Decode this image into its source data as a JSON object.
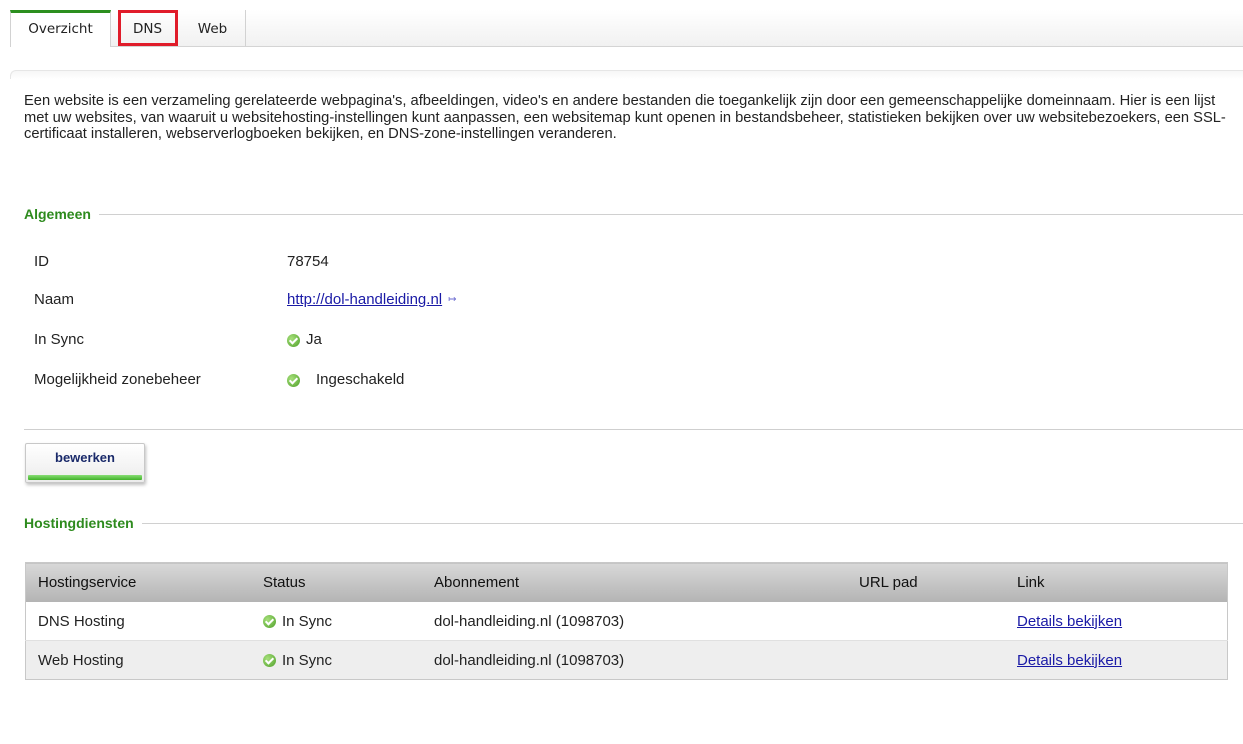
{
  "tabs": [
    {
      "label": "Overzicht"
    },
    {
      "label": "DNS"
    },
    {
      "label": "Web"
    }
  ],
  "intro": "Een website is een verzameling gerelateerde webpagina's, afbeeldingen, video's en andere bestanden die toegankelijk zijn door een gemeenschappelijke domeinnaam. Hier is een lijst met uw websites, van waaruit u websitehosting-instellingen kunt aanpassen, een websitemap kunt openen in bestandsbeheer, statistieken bekijken over uw websitebezoekers, een SSL-certificaat installeren, webserverlogboeken bekijken, en DNS-zone-instellingen veranderen.",
  "general": {
    "title": "Algemeen",
    "id_label": "ID",
    "id_value": "78754",
    "name_label": "Naam",
    "name_value": "http://dol-handleiding.nl",
    "sync_label": "In Sync",
    "sync_value": "Ja",
    "zone_label": "Mogelijkheid zonebeheer",
    "zone_value": "Ingeschakeld"
  },
  "edit_button": "bewerken",
  "hosting": {
    "title": "Hostingdiensten",
    "columns": [
      "Hostingservice",
      "Status",
      "Abonnement",
      "URL pad",
      "Link"
    ],
    "rows": [
      {
        "service": "DNS Hosting",
        "status": "In Sync",
        "subscription": "dol-handleiding.nl (1098703)",
        "url_path": "",
        "link": "Details bekijken"
      },
      {
        "service": "Web Hosting",
        "status": "In Sync",
        "subscription": "dol-handleiding.nl (1098703)",
        "url_path": "",
        "link": "Details bekijken"
      }
    ]
  },
  "colors": {
    "accent_green": "#2e8b1e",
    "highlight_red": "#e01c2a",
    "link_blue": "#1a1aa6"
  }
}
